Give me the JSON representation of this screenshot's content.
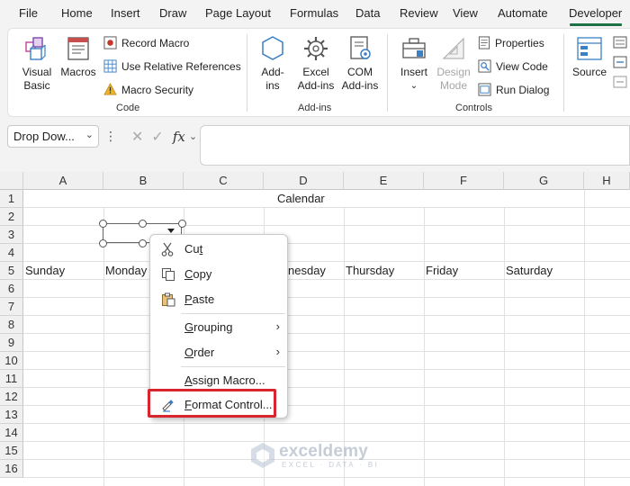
{
  "menu": {
    "tabs": [
      "File",
      "Home",
      "Insert",
      "Draw",
      "Page Layout",
      "Formulas",
      "Data",
      "Review",
      "View",
      "Automate",
      "Developer"
    ],
    "active": "Developer"
  },
  "ribbon": {
    "code": {
      "label": "Code",
      "visual_basic": [
        "Visual",
        "Basic"
      ],
      "macros": "Macros",
      "record_macro": "Record Macro",
      "use_relative": "Use Relative References",
      "macro_security": "Macro Security"
    },
    "addins": {
      "label": "Add-ins",
      "addins": [
        "Add-",
        "ins"
      ],
      "excel_addins": [
        "Excel",
        "Add-ins"
      ],
      "com_addins": [
        "COM",
        "Add-ins"
      ]
    },
    "controls": {
      "label": "Controls",
      "insert": "Insert",
      "design_mode": [
        "Design",
        "Mode"
      ],
      "properties": "Properties",
      "view_code": "View Code",
      "run_dialog": "Run Dialog"
    },
    "xml": {
      "source": "Source"
    }
  },
  "formula_bar": {
    "name_box": "Drop Dow...",
    "fx": "fx",
    "content": ""
  },
  "sheet": {
    "columns": [
      "A",
      "B",
      "C",
      "D",
      "E",
      "F",
      "G",
      "H"
    ],
    "rows": [
      "1",
      "2",
      "3",
      "4",
      "5",
      "6",
      "7",
      "8",
      "9",
      "10",
      "11",
      "12",
      "13",
      "14",
      "15",
      "16"
    ],
    "title": "Calendar",
    "days": [
      "Sunday",
      "Monday",
      "Wednesday",
      "Thursday",
      "Friday",
      "Saturday"
    ],
    "day_row_visible": [
      "Sunday",
      "Monday",
      "nesday",
      "Thursday",
      "Friday",
      "Saturday"
    ]
  },
  "context_menu": {
    "items": [
      {
        "label": "Cut",
        "icon": "scissors-icon",
        "accel": "t"
      },
      {
        "label": "Copy",
        "icon": "copy-icon",
        "accel": "C"
      },
      {
        "label": "Paste",
        "icon": "paste-icon",
        "accel": "P"
      },
      {
        "label": "Grouping",
        "icon": "",
        "submenu": true
      },
      {
        "label": "Order",
        "icon": "",
        "submenu": true
      },
      {
        "label": "Assign Macro...",
        "icon": ""
      },
      {
        "label": "Format Control...",
        "icon": "format-control-icon"
      }
    ],
    "highlighted": "Format Control...",
    "highlight_color": "#d9262e"
  },
  "watermark": {
    "name": "exceldemy",
    "sub": "EXCEL · DATA · BI"
  },
  "colors": {
    "accent": "#1e7145",
    "highlight": "#d9262e"
  }
}
